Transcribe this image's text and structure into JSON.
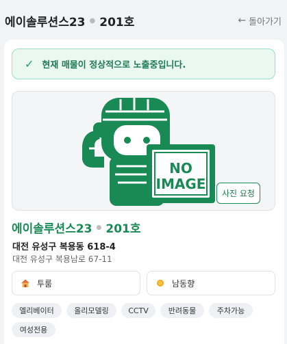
{
  "header": {
    "title": "에이솔루션스23",
    "unit": "201호",
    "back_label": "돌아가기"
  },
  "notice": {
    "text": "현재 매물이 정상적으로 노출중입니다."
  },
  "photo": {
    "placeholder_line1": "NO",
    "placeholder_line2": "IMAGE",
    "request_button": "사진 요청"
  },
  "listing": {
    "name": "에이솔루션스23",
    "unit": "201호",
    "address_lot": "대전 유성구 복용동 618-4",
    "address_road": "대전 유성구 복용남로 67-11",
    "room_type": "투룸",
    "direction": "남동향",
    "room_icon": "house-icon",
    "direction_icon": "sun-icon"
  },
  "tags": [
    "엘리베이터",
    "올리모델링",
    "CCTV",
    "반려동물",
    "주차가능",
    "여성전용"
  ],
  "colors": {
    "accent": "#1a8a55",
    "notice_bg": "#e9f8f1",
    "tag_bg": "#eef0f3"
  }
}
